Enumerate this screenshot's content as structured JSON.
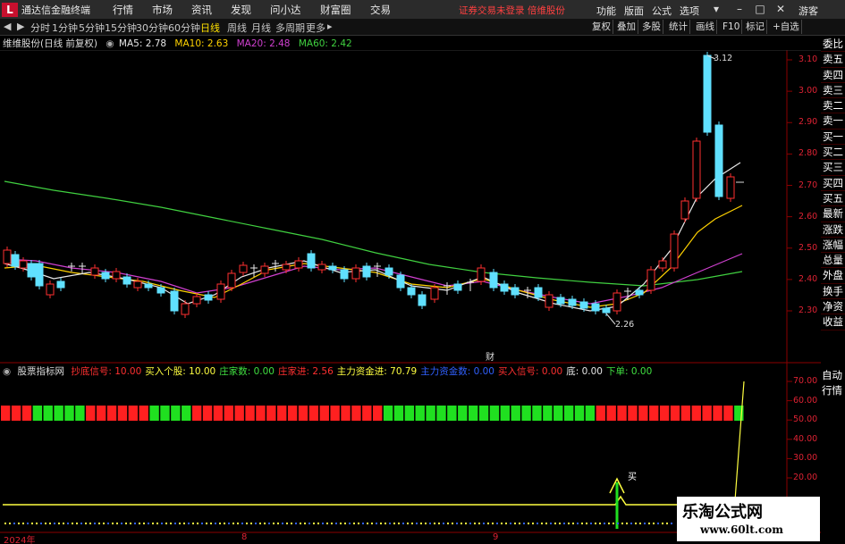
{
  "app": {
    "name": "通达信金融终端",
    "menu": [
      "行情",
      "市场",
      "资讯",
      "发现",
      "问小达",
      "财富圈",
      "交易"
    ],
    "notice": "证券交易未登录 倍维股份",
    "right_menu": [
      "功能",
      "版面",
      "公式",
      "选项"
    ],
    "guest": "游客"
  },
  "toolbar": {
    "periods": [
      "分时",
      "1分钟",
      "5分钟",
      "15分钟",
      "30分钟",
      "60分钟",
      "日线",
      "周线",
      "月线",
      "多周期",
      "更多"
    ],
    "active_period": "日线",
    "right_buttons": [
      "复权",
      "叠加",
      "多股",
      "统计",
      "画线",
      "F10",
      "标记",
      "+自选"
    ]
  },
  "chart": {
    "stock_label": "维维股份(日线 前复权)",
    "ma": [
      {
        "label": "MA5: 2.78",
        "color": "#e8e8e8"
      },
      {
        "label": "MA10: 2.63",
        "color": "#ffd200"
      },
      {
        "label": "MA20: 2.48",
        "color": "#d040d0"
      },
      {
        "label": "MA60: 2.42",
        "color": "#40d040"
      }
    ],
    "price_ticks": [
      "3.10",
      "3.00",
      "2.90",
      "2.80",
      "2.70",
      "2.60",
      "2.50",
      "2.40",
      "2.30"
    ],
    "high_marker": "3.12",
    "low_marker": "2.26",
    "cai_marker": "财"
  },
  "right_list": [
    "委比",
    "卖五",
    "卖四",
    "卖三",
    "卖二",
    "卖一",
    "买一",
    "买二",
    "买三",
    "买四",
    "买五",
    "最新",
    "涨跌",
    "涨幅",
    "总量",
    "外盘",
    "换手",
    "净资",
    "收益"
  ],
  "indicator": {
    "name": "股票指标网",
    "fields": [
      {
        "label": "抄底信号: 10.00",
        "color": "#ff3030"
      },
      {
        "label": "买入个股: 10.00",
        "color": "#ffff40"
      },
      {
        "label": "庄家数: 0.00",
        "color": "#40e040"
      },
      {
        "label": "庄家进: 2.56",
        "color": "#ff3030"
      },
      {
        "label": "主力资金进: 70.79",
        "color": "#ffff40"
      },
      {
        "label": "主力资金数: 0.00",
        "color": "#3060ff"
      },
      {
        "label": "买入信号: 0.00",
        "color": "#ff3030"
      },
      {
        "label": "底: 0.00",
        "color": "#e8e8e8"
      },
      {
        "label": "下单: 0.00",
        "color": "#40e040"
      }
    ],
    "side_labels": [
      "自动",
      "行情"
    ],
    "ticks": [
      "70.00",
      "60.00",
      "50.00",
      "40.00",
      "30.00",
      "20.00"
    ],
    "buy_marker": "买"
  },
  "x_dates": [
    "2024年",
    "8",
    "9"
  ],
  "watermark": {
    "title": "乐淘公式网",
    "url": "www.60lt.com"
  }
}
